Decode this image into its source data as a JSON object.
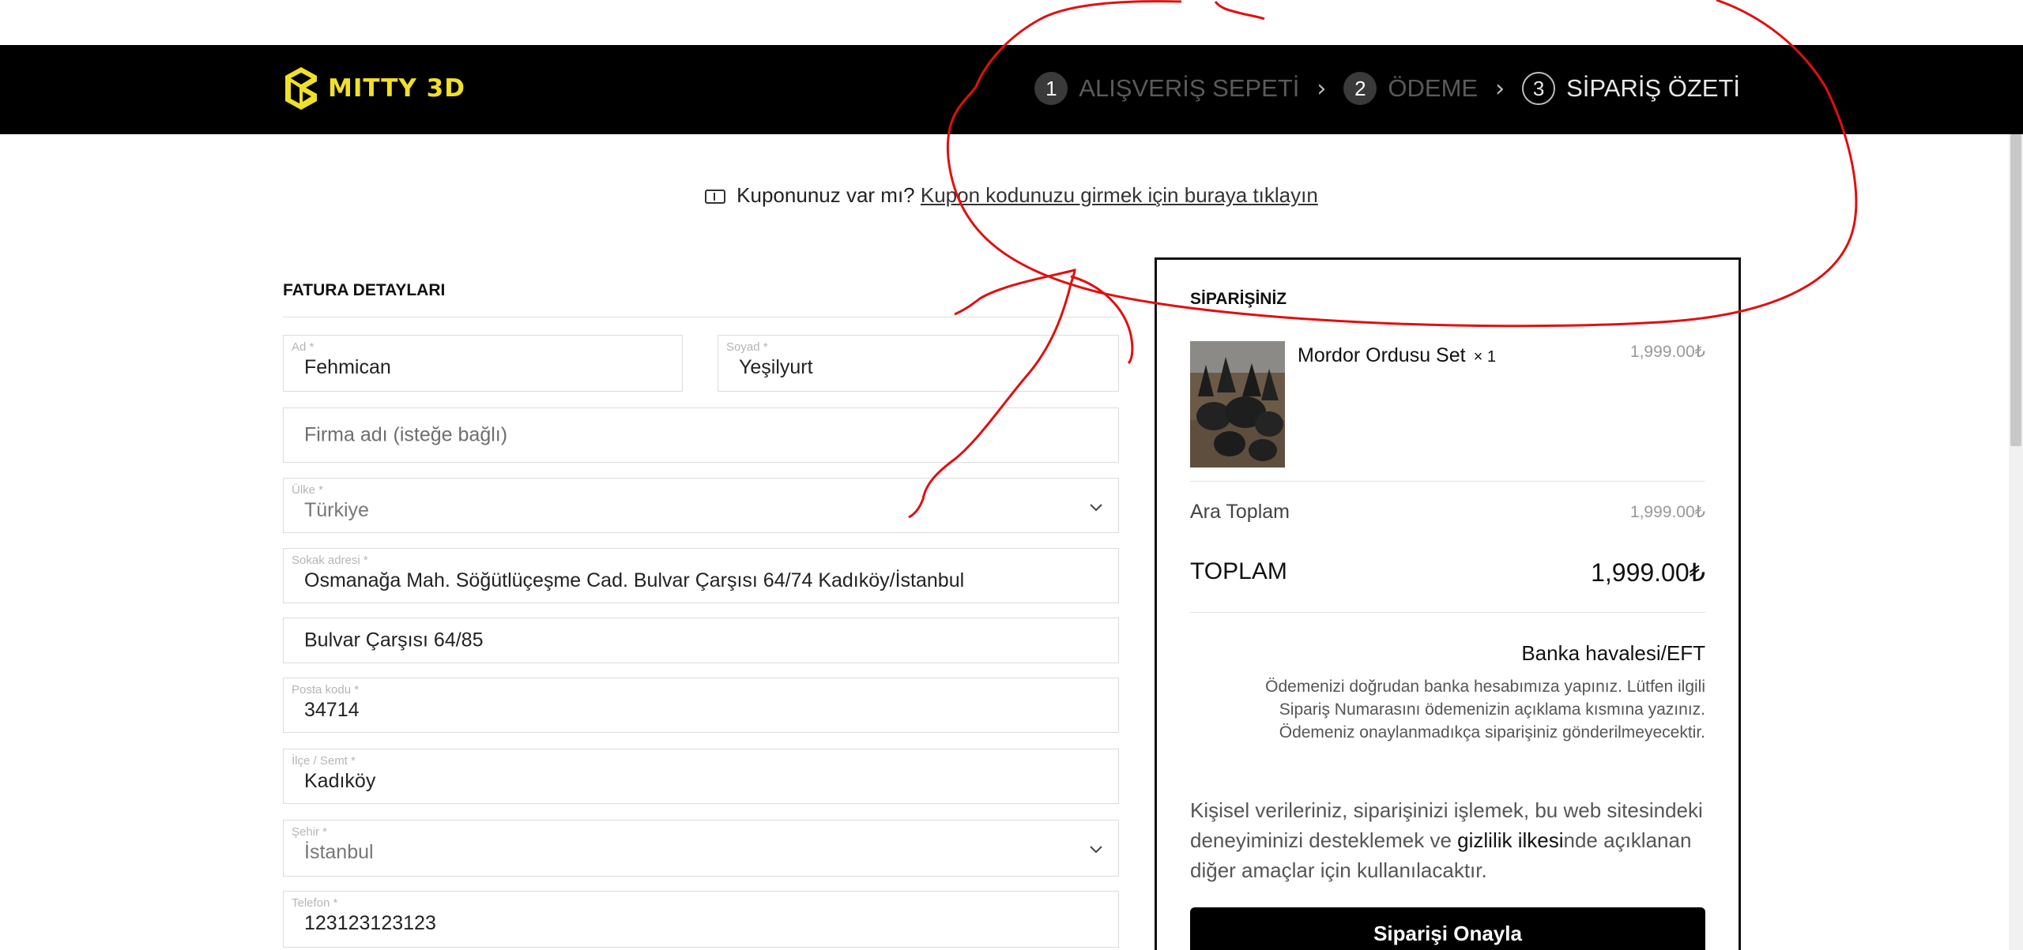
{
  "brand": {
    "name": "MITTY 3D",
    "color": "#f0e02a"
  },
  "steps": [
    {
      "num": "1",
      "label": "ALIŞVERİŞ SEPETİ"
    },
    {
      "num": "2",
      "label": "ÖDEME"
    },
    {
      "num": "3",
      "label": "SİPARİŞ ÖZETİ"
    }
  ],
  "coupon": {
    "question": "Kuponunuz var mı?",
    "link": "Kupon kodunuzu girmek için buraya tıklayın"
  },
  "billing": {
    "title": "FATURA DETAYLARI",
    "first_name": {
      "label": "Ad *",
      "value": "Fehmican"
    },
    "last_name": {
      "label": "Soyad *",
      "value": "Yeşilyurt"
    },
    "company": {
      "placeholder": "Firma adı (isteğe bağlı)"
    },
    "country": {
      "label": "Ülke *",
      "value": "Türkiye"
    },
    "street": {
      "label": "Sokak adresi *",
      "value": "Osmanağa Mah. Söğütlüçeşme Cad. Bulvar Çarşısı 64/74 Kadıköy/İstanbul"
    },
    "street2": {
      "value": "Bulvar Çarşısı 64/85"
    },
    "postcode": {
      "label": "Posta kodu *",
      "value": "34714"
    },
    "district": {
      "label": "İlçe / Semt *",
      "value": "Kadıköy"
    },
    "city": {
      "label": "Şehir *",
      "value": "İstanbul"
    },
    "phone": {
      "label": "Telefon *",
      "value": "123123123123"
    }
  },
  "order": {
    "title": "SİPARİŞİNİZ",
    "item": {
      "name": "Mordor Ordusu Set",
      "qty": "× 1",
      "price": "1,999.00₺"
    },
    "subtotal": {
      "label": "Ara Toplam",
      "value": "1,999.00₺"
    },
    "total": {
      "label": "TOPLAM",
      "value": "1,999.00₺"
    },
    "payment": {
      "title": "Banka havalesi/EFT",
      "description": "Ödemenizi doğrudan banka hesabımıza yapınız. Lütfen ilgili Sipariş Numarasını ödemenizin açıklama kısmına yazınız. Ödemeniz onaylanmadıkça siparişiniz gönderilmeyecektir."
    },
    "privacy": {
      "before": "Kişisel verileriniz, siparişinizi işlemek, bu web sitesindeki deneyiminizi desteklemek ve ",
      "link": "gizlilik ilkesi",
      "after": "nde açıklanan diğer amaçlar için kullanılacaktır."
    },
    "confirm_label": "Siparişi Onayla"
  },
  "icons": {
    "coupon": "ticket-icon",
    "dropdown": "chevron-down-icon",
    "step_separator": "chevron-right-icon",
    "logo": "cube-logo-icon"
  },
  "colors": {
    "header_bg": "#000000",
    "annotation": "#e01010"
  }
}
